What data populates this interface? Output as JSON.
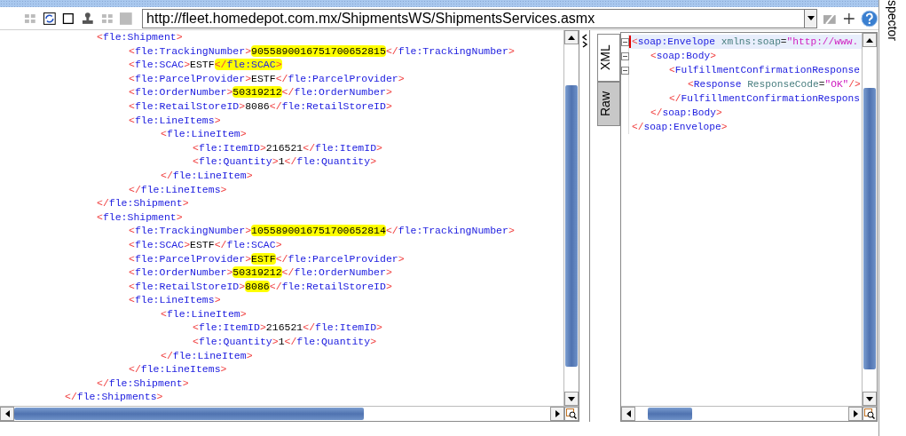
{
  "toolbar": {
    "url": "http://fleet.homedepot.com.mx/ShipmentsWS/ShipmentsServices.asmx"
  },
  "request_editor": {
    "tree": {
      "close": "</fle:Shipments>",
      "children": [
        {
          "open": "<fle:Shipment>",
          "close": "</fle:Shipment>",
          "children": [
            {
              "open": "<fle:TrackingNumber>",
              "value": "9055890016751700652815",
              "close": "</fle:TrackingNumber>",
              "value_highlighted": true
            },
            {
              "open": "<fle:SCAC>",
              "value": "ESTF",
              "close": "</fle:SCAC>",
              "close_highlighted": true
            },
            {
              "open": "<fle:ParcelProvider>",
              "value": "ESTF",
              "close": "</fle:ParcelProvider>"
            },
            {
              "open": "<fle:OrderNumber>",
              "value": "50319212",
              "close": "</fle:OrderNumber>",
              "value_highlighted": true
            },
            {
              "open": "<fle:RetailStoreID>",
              "value": "8086",
              "close": "</fle:RetailStoreID>"
            },
            {
              "open": "<fle:LineItems>",
              "close": "</fle:LineItems>",
              "children": [
                {
                  "open": "<fle:LineItem>",
                  "close": "</fle:LineItem>",
                  "children": [
                    {
                      "open": "<fle:ItemID>",
                      "value": "216521",
                      "close": "</fle:ItemID>"
                    },
                    {
                      "open": "<fle:Quantity>",
                      "value": "1",
                      "close": "</fle:Quantity>"
                    }
                  ]
                }
              ]
            }
          ]
        },
        {
          "open": "<fle:Shipment>",
          "close": "</fle:Shipment>",
          "children": [
            {
              "open": "<fle:TrackingNumber>",
              "value": "1055890016751700652814",
              "close": "</fle:TrackingNumber>",
              "value_highlighted": true
            },
            {
              "open": "<fle:SCAC>",
              "value": "ESTF",
              "close": "</fle:SCAC>"
            },
            {
              "open": "<fle:ParcelProvider>",
              "value": "ESTF",
              "close": "</fle:ParcelProvider>",
              "value_highlighted": true
            },
            {
              "open": "<fle:OrderNumber>",
              "value": "50319212",
              "close": "</fle:OrderNumber>",
              "value_highlighted": true
            },
            {
              "open": "<fle:RetailStoreID>",
              "value": "8086",
              "close": "</fle:RetailStoreID>",
              "value_highlighted": true
            },
            {
              "open": "<fle:LineItems>",
              "close": "</fle:LineItems>",
              "children": [
                {
                  "open": "<fle:LineItem>",
                  "close": "</fle:LineItem>",
                  "children": [
                    {
                      "open": "<fle:ItemID>",
                      "value": "216521",
                      "close": "</fle:ItemID>"
                    },
                    {
                      "open": "<fle:Quantity>",
                      "value": "1",
                      "close": "</fle:Quantity>"
                    }
                  ]
                }
              ]
            }
          ]
        }
      ]
    }
  },
  "response_viewer": {
    "tabs": [
      {
        "label": "XML",
        "selected": true
      },
      {
        "label": "Raw",
        "selected": false
      }
    ],
    "tree": {
      "open": "<soap:Envelope xmlns:soap=\"http://www.",
      "close": "</soap:Envelope>",
      "expanded": true,
      "current": true,
      "children": [
        {
          "open": "<soap:Body>",
          "close": "</soap:Body>",
          "expanded": true,
          "children": [
            {
              "open": "<FulfillmentConfirmationResponse",
              "close": "</FulfillmentConfirmationRespons",
              "expanded": true,
              "children": [
                {
                  "open": "<Response ResponseCode=\"OK\"/>"
                }
              ]
            }
          ]
        }
      ]
    }
  },
  "side_panel": {
    "title": "spector"
  }
}
